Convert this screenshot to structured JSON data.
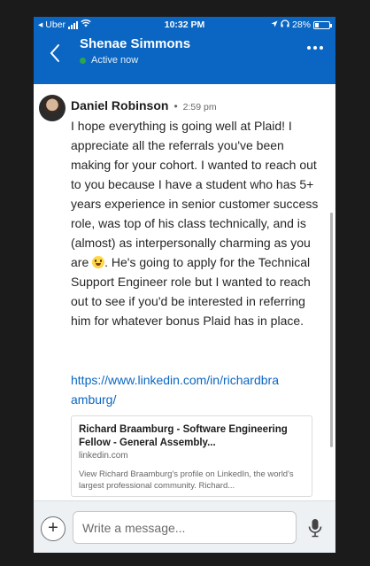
{
  "status_bar": {
    "carrier": "Uber",
    "time": "10:32 PM",
    "battery": "28%",
    "battery_level": 0.28
  },
  "header": {
    "contact_name": "Shenae Simmons",
    "presence": "Active now",
    "back_icon": "chevron-left-icon",
    "more_icon": "more-horizontal-icon"
  },
  "message": {
    "sender": "Daniel Robinson",
    "separator": "•",
    "time": "2:59 pm",
    "text_part1": "I hope everything is going well at Plaid! I appreciate all the referrals you've been making for your cohort. I wanted to reach out to you because I have a student who has 5+ years experience in senior customer success role, was top of his class technically, and is (almost) as interpersonally charming as you are ",
    "emoji": "grinning-face-emoji",
    "text_part2": ". He's going to apply for the Technical Support Engineer role but I wanted to reach out to see if you'd be interested in referring him for whatever bonus Plaid has in place.",
    "link": "https://www.linkedin.com/in/richardbraamburg/"
  },
  "link_preview": {
    "title": "Richard Braamburg - Software Engineering Fellow - General Assembly...",
    "domain": "linkedin.com",
    "description": "View Richard Braamburg's profile on LinkedIn, the world's largest professional community. Richard..."
  },
  "compose": {
    "placeholder": "Write a message...",
    "add_label": "+",
    "mic_icon": "microphone-icon"
  },
  "colors": {
    "brand": "#0a66c2",
    "link": "#0a66c2",
    "presence": "#2ea44f"
  }
}
